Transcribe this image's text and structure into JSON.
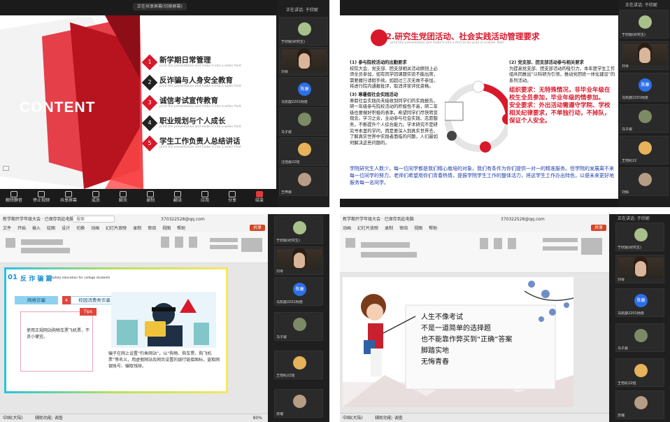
{
  "q1": {
    "top_banner": "正在共享屏幕(切换屏幕)",
    "slide_title": "CONTENT",
    "items": [
      {
        "num": "1",
        "title": "新学期日常管理",
        "sub": "print the presentation and make it into a wider field"
      },
      {
        "num": "2",
        "title": "反诈骗与人身安全教育",
        "sub": "print the presentation and make it into a wider field"
      },
      {
        "num": "3",
        "title": "诚信考试宣传教育",
        "sub": "print the presentation and make it into a wider field"
      },
      {
        "num": "4",
        "title": "职业规划与个人成长",
        "sub": "print the presentation and make it into a wider field"
      },
      {
        "num": "5",
        "title": "学生工作负责人总结讲话",
        "sub": "print the presentation and make it into a wider field"
      }
    ],
    "toolbar": [
      "解除静音",
      "停止视频",
      "共享屏幕",
      "成员",
      "聊天",
      "录制",
      "翻译",
      "应用",
      "分享",
      "结束"
    ],
    "gallery_header": "正在讲话: 于欣妮",
    "gallery": [
      "于欣妮(研究生)",
      "刘琴",
      "马凯旋2201杨逸",
      "马子骏",
      "汪佳晨22班",
      "王梓晨"
    ]
  },
  "q2": {
    "gallery_header": "正在讲话: 于欣妮",
    "slide_title": "2.研究生党团活动、社会实践活动管理要求",
    "slide_sub": "print the presentation and make it into a firm to be used in a wider field",
    "left_h1": "(1) 参与院校活动的出勤要求",
    "left_p1": "校院大会、党支部、团支部相关活动原则上必须全员参加，如有同学因课题实验不能出席，需要履行请假手续。如超过三次无故不参加，将进行院内通报批评，取消评奖评优资格。",
    "left_h2": "(3) 寒暑假社会实践活动",
    "left_p2": "寒假社会实践尚未接收到同学们的实践报告，研一年级参与院校活动的积极性不高，研二年级也要做好积极的表率。希望同学们尽快转变观念，学习之余，主动参与社会实践、志愿服务，不断提升个人综合能力。学术研究不是研究书本里的学问，而是要深入到真实世界去，了解真实世界中实践者面临的问题，人们最如何解决这些问题的。",
    "right_h1": "(2) 党支部、团支部活动参与相关要求",
    "right_p1": "为提高党支部、团支部活动的吸引力，本年度学生工作组共同推出“以科研为引领，推动党团班一体化建设”的系列活动。",
    "right_req": "组织要求：无特殊情况，非毕业年级在校生全员参加，毕业年级的情参加。",
    "right_safe": "安全要求：外出活动需遵守学院、学校相关纪律要求，不单独行动，不掉队，保证个人安全。",
    "bottom": "学院研究生人数少，每一位同学都是我们精心栽培的对象，我们有条件为你们提供一对一的精准服务。但学院的发展离不来每一位同学的努力，老师们希望用你们青春热情，提振学院学生工作的整体活力，将这学生工作办出特色，以便未来更好地服务每一名同学。",
    "gallery": [
      "于欣妮(研究生)",
      "刘琴",
      "马凯旋2201杨逸",
      "马子骏",
      "王恺纶22",
      "刘佩"
    ]
  },
  "q3": {
    "window_title": "新学期开学年级大会 · 已保存到此电脑",
    "search": "搜索",
    "account": "370322528@qq.com",
    "share": "共享",
    "tabs": [
      "文件",
      "开始",
      "插入",
      "绘图",
      "设计",
      "切换",
      "动画",
      "幻灯片放映",
      "录制",
      "审阅",
      "视图",
      "帮助"
    ],
    "slide_num": "01",
    "slide_heading": "反 诈 骗 篇",
    "slide_heading_en": "Safety education for college students",
    "tab_a": "网络诈骗",
    "tab_b_num": "4",
    "tab_b": "校园消费类诈骗",
    "tips": "Tips",
    "card_text": "使用正规网站购物车票飞机票，不贪小便宜。",
    "desc": "骗子在网上设置“钓鱼网站”，以“购物、购车票、购飞机票”等名义，用虚假网站及网页设置的银行链接图标，盗取网银账号、骗取钱财。",
    "status_left": "中国(大陆)",
    "status_access": "辅助功能: 调查",
    "zoom": "80%",
    "gallery_header": "正在讲话",
    "gallery": [
      "于欣妮(研究生)",
      "刘琴",
      "马凯旋2201杨逸",
      "马子骏",
      "王恺纶22班",
      "苏瑞"
    ]
  },
  "q4": {
    "window_title": "新学期开学年级大会 · 已保存到此电脑",
    "account": "370322528@qq.com",
    "share": "共享",
    "tabs": [
      "动画",
      "幻灯片放映",
      "录制",
      "审阅",
      "视图",
      "帮助"
    ],
    "poem": [
      "人生不像考试",
      "不是一道简单的选择题",
      "也不能靠作弊买到“正确”答案",
      "脚踏实地",
      "无悔青春"
    ],
    "status_left": "中国(大陆)",
    "status_access": "辅助功能: 调查",
    "gallery_header": "正在讲话: 于欣妮",
    "gallery": [
      "于欣妮(研究生)",
      "刘琴",
      "马凯旋2201杨逸",
      "马子骏",
      "王恺纶22班",
      "苏瑞"
    ]
  },
  "colors": {
    "accent": "#d7192b",
    "blue": "#2d6fe8",
    "dark": "#1b1b1b"
  }
}
